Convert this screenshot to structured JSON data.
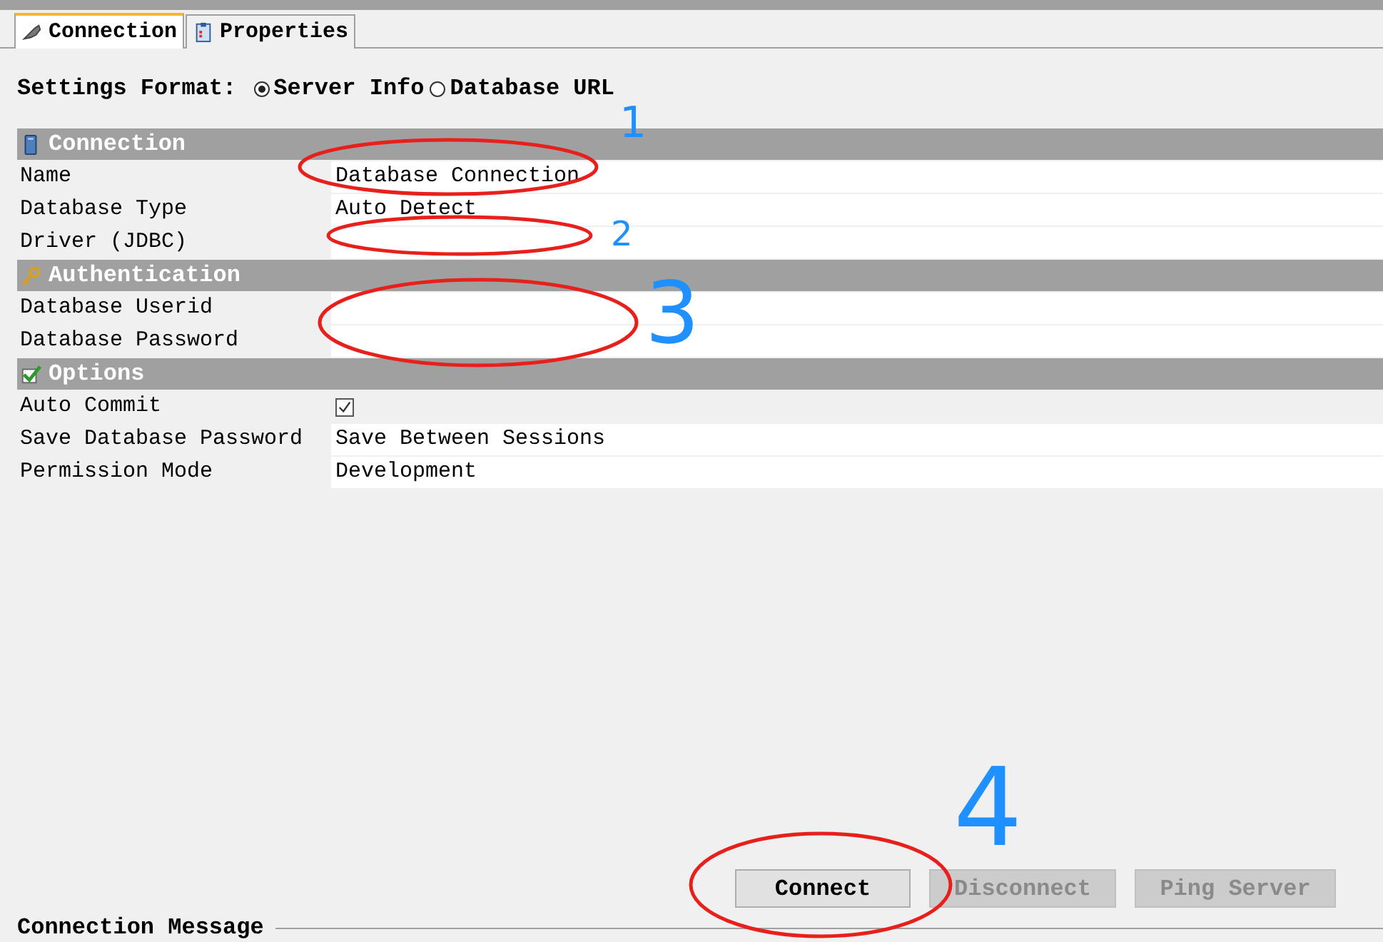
{
  "tabs": [
    {
      "label": "Connection",
      "selected": true
    },
    {
      "label": "Properties",
      "selected": false
    }
  ],
  "settings_format": {
    "label": "Settings Format:",
    "options": [
      {
        "label": "Server Info",
        "selected": true
      },
      {
        "label": "Database URL",
        "selected": false
      }
    ]
  },
  "sections": [
    {
      "title": "Connection",
      "rows": [
        {
          "label": "Name",
          "kind": "text",
          "value": "Database Connection"
        },
        {
          "label": "Database Type",
          "kind": "text",
          "value": "Auto Detect"
        },
        {
          "label": "Driver (JDBC)",
          "kind": "text"
        }
      ]
    },
    {
      "title": "Authentication",
      "rows": [
        {
          "label": "Database Userid",
          "kind": "text"
        },
        {
          "label": "Database Password",
          "kind": "text"
        }
      ]
    },
    {
      "title": "Options",
      "rows": [
        {
          "label": "Auto Commit",
          "kind": "checkbox",
          "checked": true
        },
        {
          "label": "Save Database Password",
          "kind": "text",
          "value": "Save Between Sessions"
        },
        {
          "label": "Permission Mode",
          "kind": "text",
          "value": "Development"
        }
      ]
    }
  ],
  "buttons": [
    {
      "label": "Connect",
      "disabled": false
    },
    {
      "label": "Disconnect",
      "disabled": true
    },
    {
      "label": "Ping Server",
      "disabled": true
    }
  ],
  "connection_message": {
    "title": "Connection Message"
  },
  "annotations": [
    {
      "label": "1"
    },
    {
      "label": "2"
    },
    {
      "label": "3"
    },
    {
      "label": "4"
    }
  ]
}
